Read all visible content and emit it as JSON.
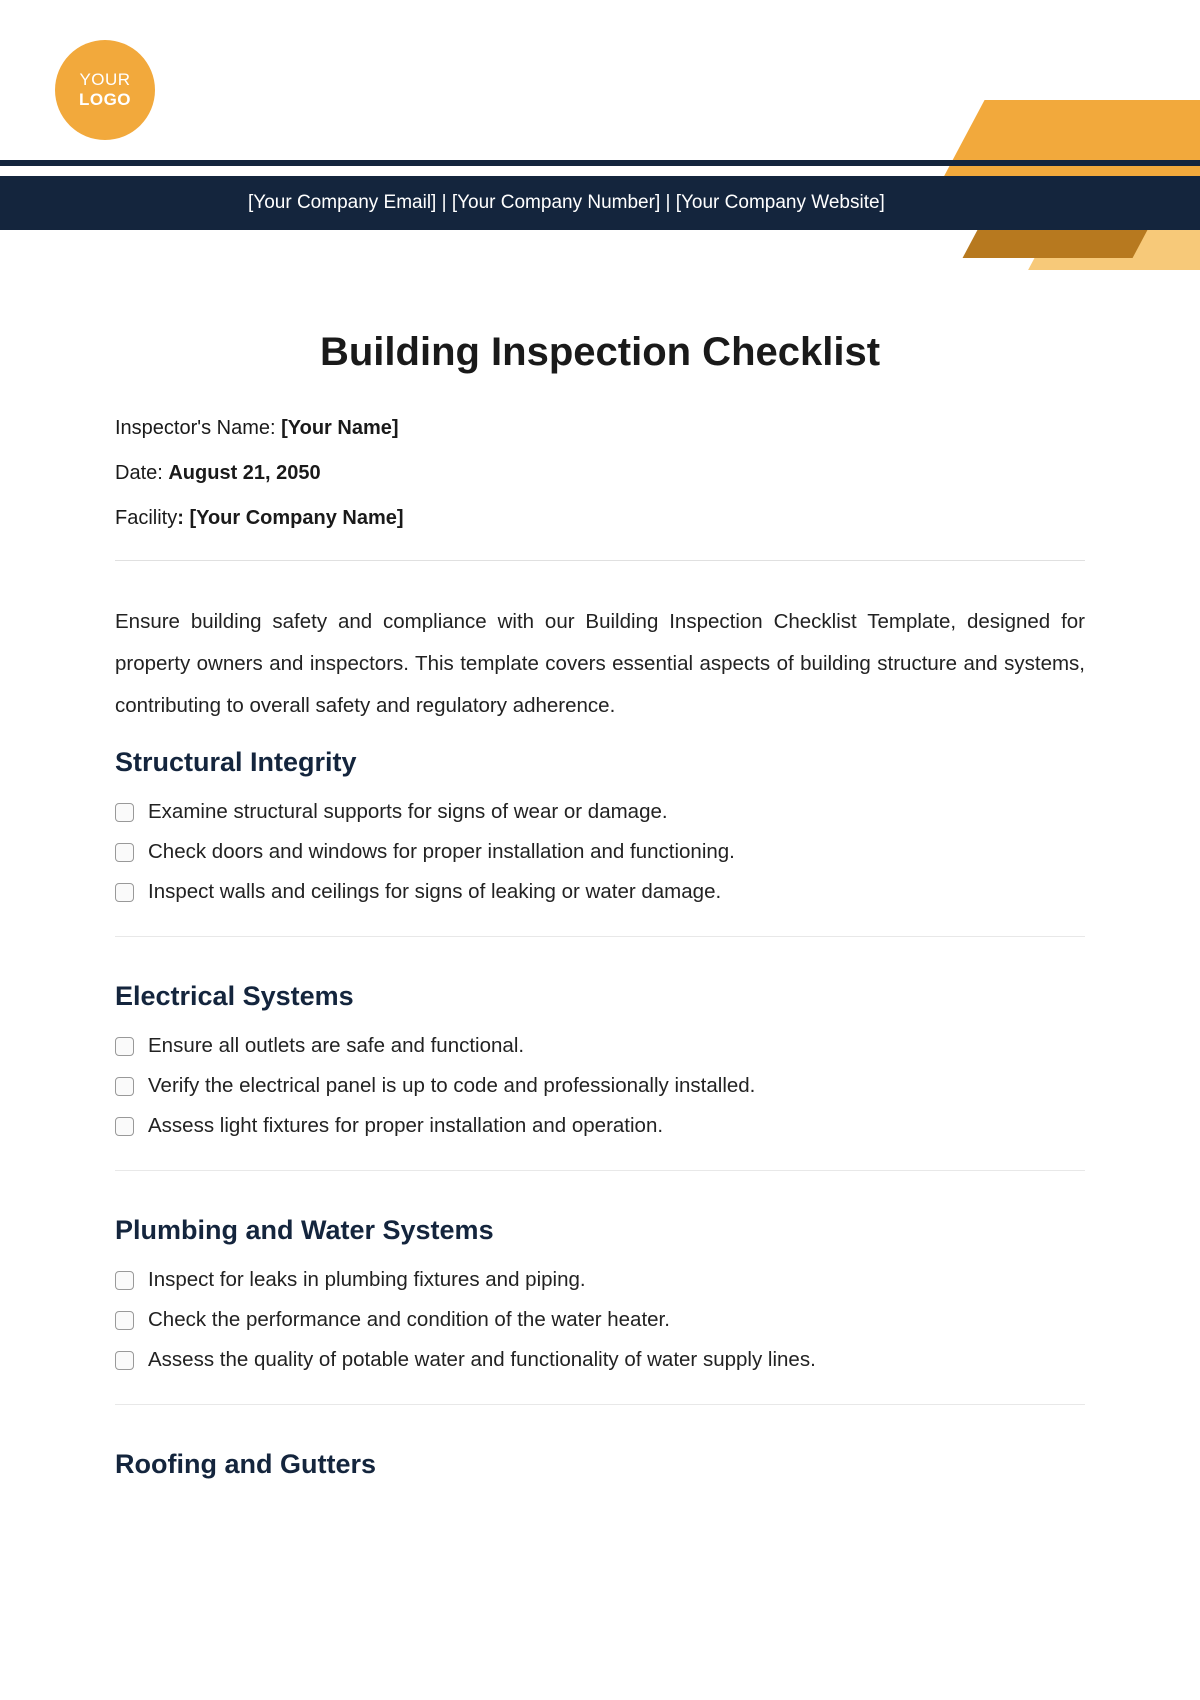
{
  "logo": {
    "line1": "YOUR",
    "line2": "LOGO"
  },
  "header": {
    "contact_line": "[Your Company Email] | [Your Company Number] | [Your Company Website]"
  },
  "title": "Building Inspection Checklist",
  "meta": {
    "inspector_label": "Inspector's Name: ",
    "inspector_value": "[Your Name]",
    "date_label": "Date: ",
    "date_value": "August 21, 2050",
    "facility_label": "Facility",
    "facility_sep": ": ",
    "facility_value": "[Your Company Name]"
  },
  "intro": "Ensure building safety and compliance with our Building Inspection Checklist Template, designed for property owners and inspectors. This template covers essential aspects of building structure and systems, contributing to overall safety and regulatory adherence.",
  "sections": [
    {
      "heading": "Structural Integrity",
      "items": [
        "Examine structural supports for signs of wear or damage.",
        "Check doors and windows for proper installation and functioning.",
        "Inspect walls and ceilings for signs of leaking or water damage."
      ]
    },
    {
      "heading": "Electrical Systems",
      "items": [
        "Ensure all outlets are safe and functional.",
        "Verify the electrical panel is up to code and professionally installed.",
        "Assess light fixtures for proper installation and operation."
      ]
    },
    {
      "heading": "Plumbing and Water Systems",
      "items": [
        "Inspect for leaks in plumbing fixtures and piping.",
        "Check the performance and condition of the water heater.",
        "Assess the quality of potable water and functionality of water supply lines."
      ]
    },
    {
      "heading": "Roofing and Gutters",
      "items": []
    }
  ]
}
